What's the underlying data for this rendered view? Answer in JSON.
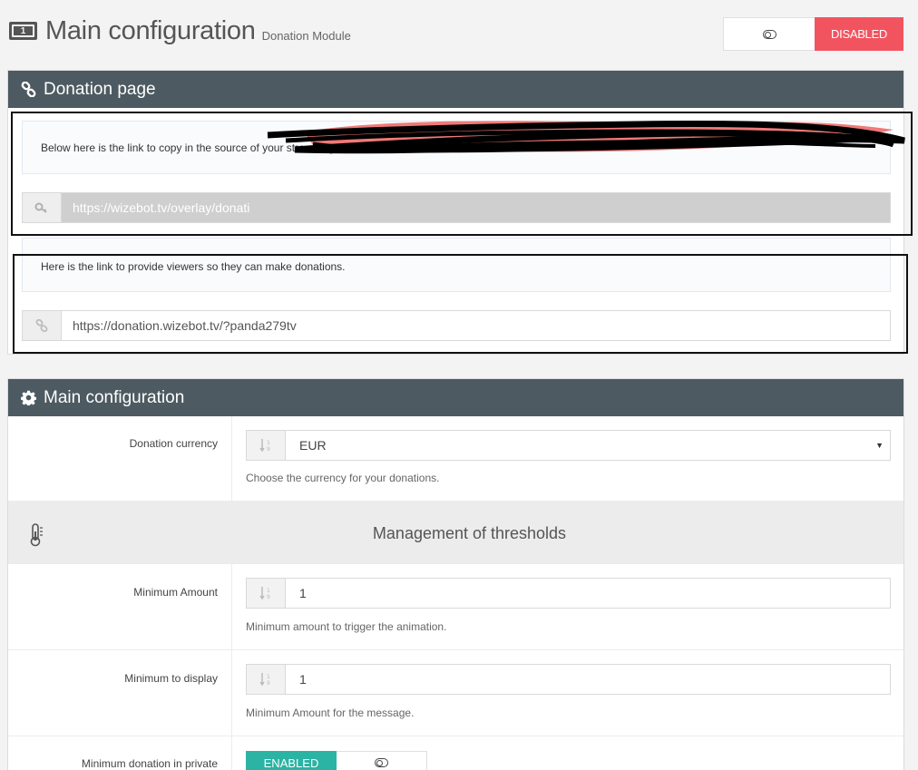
{
  "header": {
    "title": "Main configuration",
    "subtitle": "Donation Module",
    "icon": "money-bill-icon",
    "status_toggle": {
      "on_label": "",
      "off_label": "DISABLED",
      "state": "disabled",
      "color": "#f2545f"
    }
  },
  "donation_panel": {
    "title": "Donation page",
    "icon": "link-icon",
    "overlay_info": "Below here is the link to copy in the source of your streaming software.",
    "overlay_url": "https://wizebot.tv/overlay/donati",
    "viewer_info": "Here is the link to provide viewers so they can make donations.",
    "viewer_url": "https://donation.wizebot.tv/?panda279tv"
  },
  "config_panel": {
    "title": "Main configuration",
    "icon": "gear-icon",
    "currency": {
      "label": "Donation currency",
      "value": "EUR",
      "help": "Choose the currency for your donations."
    },
    "thresholds_title": "Management of thresholds",
    "min_amount": {
      "label": "Minimum Amount",
      "value": "1",
      "help": "Minimum amount to trigger the animation."
    },
    "min_display": {
      "label": "Minimum to display",
      "value": "1",
      "help": "Minimum Amount for the message."
    },
    "min_private": {
      "label": "Minimum donation in private",
      "toggle_label": "ENABLED",
      "state": "enabled",
      "color": "#2bb3a4"
    }
  },
  "colors": {
    "panel_header": "#4d5a61",
    "disabled": "#f2545f",
    "enabled": "#2bb3a4"
  }
}
